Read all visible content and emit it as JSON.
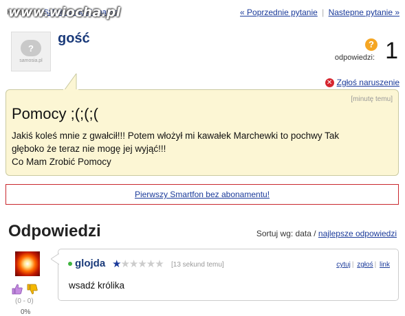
{
  "topbar": {
    "category_prefix": "Kategoria:",
    "category_link": "Szkoły, praca i finanse",
    "watermark": "www.wiocha.pl",
    "prev_link": "« Poprzednie pytanie",
    "next_link": "Nastepne pytanie »",
    "separator": "|"
  },
  "user": {
    "name": "gość",
    "avatar_brand": "samosia.pl",
    "avatar_glyph": "?"
  },
  "answers_counter": {
    "label": "odpowiedzi:",
    "count": "1",
    "icon": "question-icon"
  },
  "report": {
    "label": "Zgłoś naruszenie",
    "icon": "close-icon"
  },
  "question": {
    "time": "[minutę temu]",
    "title": "Pomocy ;(;(;(",
    "body_line1": "Jakiś koleś mnie z gwałcił!!! Potem włożył mi kawałek Marchewki to pochwy Tak",
    "body_line2": "głęboko że teraz nie mogę jej wyjąć!!!",
    "body_line3": "Co Mam Zrobić Pomocy"
  },
  "promo": {
    "label": "Pierwszy Smartfon bez abonamentu!"
  },
  "answers_section": {
    "header": "Odpowiedzi",
    "sort_label": "Sortuj wg: data /",
    "sort_link": "najlepsze odpowiedzi"
  },
  "answer": {
    "author": "glojda",
    "rating_stars": 1,
    "rating_max": 6,
    "time": "[13 sekund temu]",
    "action_quote": "cytuj",
    "action_report": "zgłoś",
    "action_link": "link",
    "body": "wsadź królika",
    "votes": "(0 - 0)",
    "percent": "0%",
    "thumb_up_color": "#b06fd1",
    "thumb_down_color": "#f0a500"
  }
}
